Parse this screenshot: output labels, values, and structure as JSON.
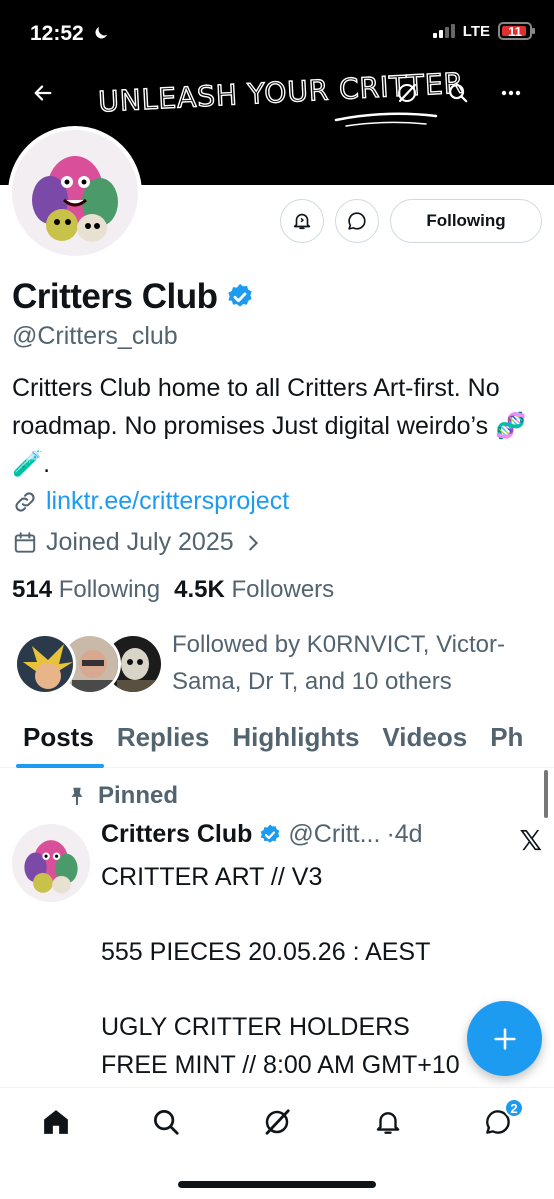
{
  "status_bar": {
    "time": "12:52",
    "network": "LTE",
    "battery": "11"
  },
  "banner": {
    "text": "UNLEASH YOUR CRITTER"
  },
  "profile": {
    "name": "Critters Club",
    "handle": "@Critters_club",
    "bio": "Critters Club home to all Critters Art-first. No roadmap. No promises Just digital weirdo’s 🧬🧪.",
    "link": "linktr.ee/crittersproject",
    "joined": "Joined July 2025",
    "following_count": "514",
    "following_label": "Following",
    "followers_count": "4.5K",
    "followers_label": "Followers",
    "followed_by": "Followed by K0RNVICT, Victor-Sama, Dr T, and 10 others",
    "following_button": "Following"
  },
  "tabs": [
    "Posts",
    "Replies",
    "Highlights",
    "Videos",
    "Ph"
  ],
  "pinned_post": {
    "pinned_label": "Pinned",
    "name": "Critters Club",
    "handle": "@Critt...",
    "time": "·4d",
    "body": "CRITTER ART // V3\n\n555 PIECES  20.05.26 : AEST\n\nUGLY CRITTER HOLDERS\nFREE MINT // 8:00 AM GMT+10"
  },
  "bottom_nav": {
    "messages_badge": "2"
  },
  "colors": {
    "accent": "#1d9bf0",
    "text": "#0f1419",
    "secondary": "#536471"
  },
  "icons": [
    "back-arrow-icon",
    "grok-icon",
    "search-icon",
    "more-icon",
    "notification-bell-icon",
    "message-icon",
    "verified-badge-icon",
    "link-icon",
    "calendar-icon",
    "chevron-right-icon",
    "pin-icon",
    "x-logo-icon",
    "plus-icon",
    "home-icon",
    "notifications-icon",
    "messages-icon"
  ]
}
